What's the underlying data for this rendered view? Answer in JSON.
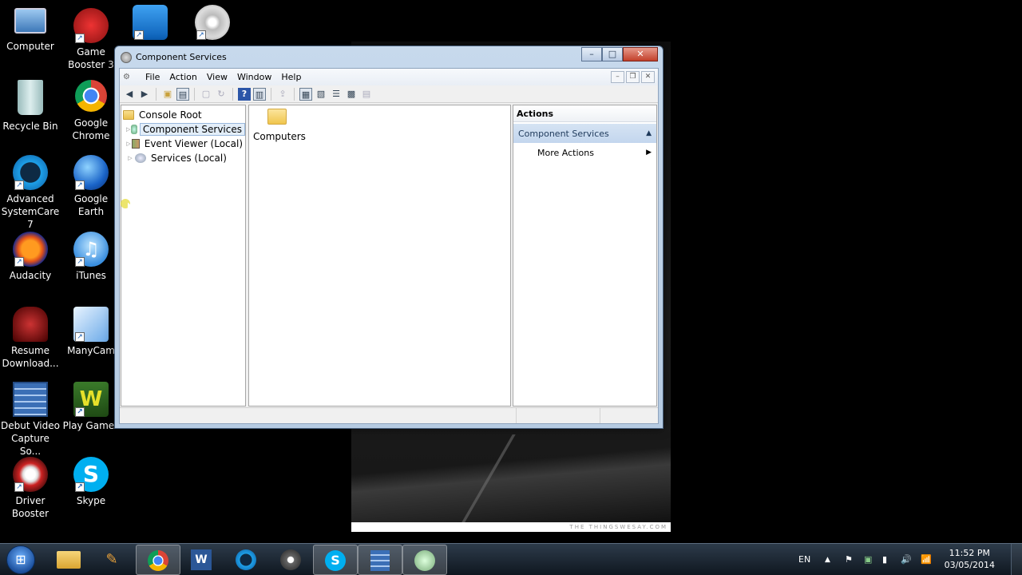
{
  "desktop": {
    "icons": [
      {
        "label": "Computer",
        "icon": "computer-icon"
      },
      {
        "label": "Game Booster 3",
        "icon": "game-booster-icon"
      },
      {
        "label": "",
        "icon": "teamviewer-icon"
      },
      {
        "label": "",
        "icon": "disc-burner-icon"
      },
      {
        "label": "Recycle Bin",
        "icon": "recycle-bin-icon"
      },
      {
        "label": "Google Chrome",
        "icon": "chrome-icon"
      },
      {
        "label": "Advanced SystemCare 7",
        "icon": "advanced-systemcare-icon"
      },
      {
        "label": "Google Earth",
        "icon": "google-earth-icon"
      },
      {
        "label": "Audacity",
        "icon": "audacity-icon"
      },
      {
        "label": "iTunes",
        "icon": "itunes-icon"
      },
      {
        "label": "Resume Download...",
        "icon": "resume-download-icon"
      },
      {
        "label": "ManyCam",
        "icon": "manycam-icon"
      },
      {
        "label": "Debut Video Capture So...",
        "icon": "debut-video-icon"
      },
      {
        "label": "Play Games",
        "icon": "play-games-icon"
      },
      {
        "label": "Driver Booster",
        "icon": "driver-booster-icon"
      },
      {
        "label": "Skype",
        "icon": "skype-icon"
      }
    ]
  },
  "background_watermark": "THE THINGSWESAY.COM",
  "window": {
    "title": "Component Services",
    "menu": [
      "File",
      "Action",
      "View",
      "Window",
      "Help"
    ],
    "tree": [
      {
        "label": "Console Root",
        "icon": "folder-icon"
      },
      {
        "label": "Component Services",
        "icon": "component-services-icon",
        "selected": true
      },
      {
        "label": "Event Viewer (Local)",
        "icon": "event-viewer-icon"
      },
      {
        "label": "Services (Local)",
        "icon": "services-icon"
      }
    ],
    "center_items": [
      {
        "label": "Computers",
        "icon": "folder-icon"
      }
    ],
    "actions": {
      "header": "Actions",
      "section": "Component Services",
      "items": [
        "More Actions"
      ]
    }
  },
  "taskbar": {
    "apps": [
      "explorer",
      "paint-tools",
      "chrome",
      "word",
      "advanced-systemcare",
      "steam",
      "skype",
      "debut-video",
      "component-services"
    ],
    "language": "EN",
    "time": "11:52 PM",
    "date": "03/05/2014"
  },
  "colors": {
    "window_frame": "#b6cbe2",
    "selection": "#e3eef9",
    "actions_section": "#c3d6ee"
  }
}
